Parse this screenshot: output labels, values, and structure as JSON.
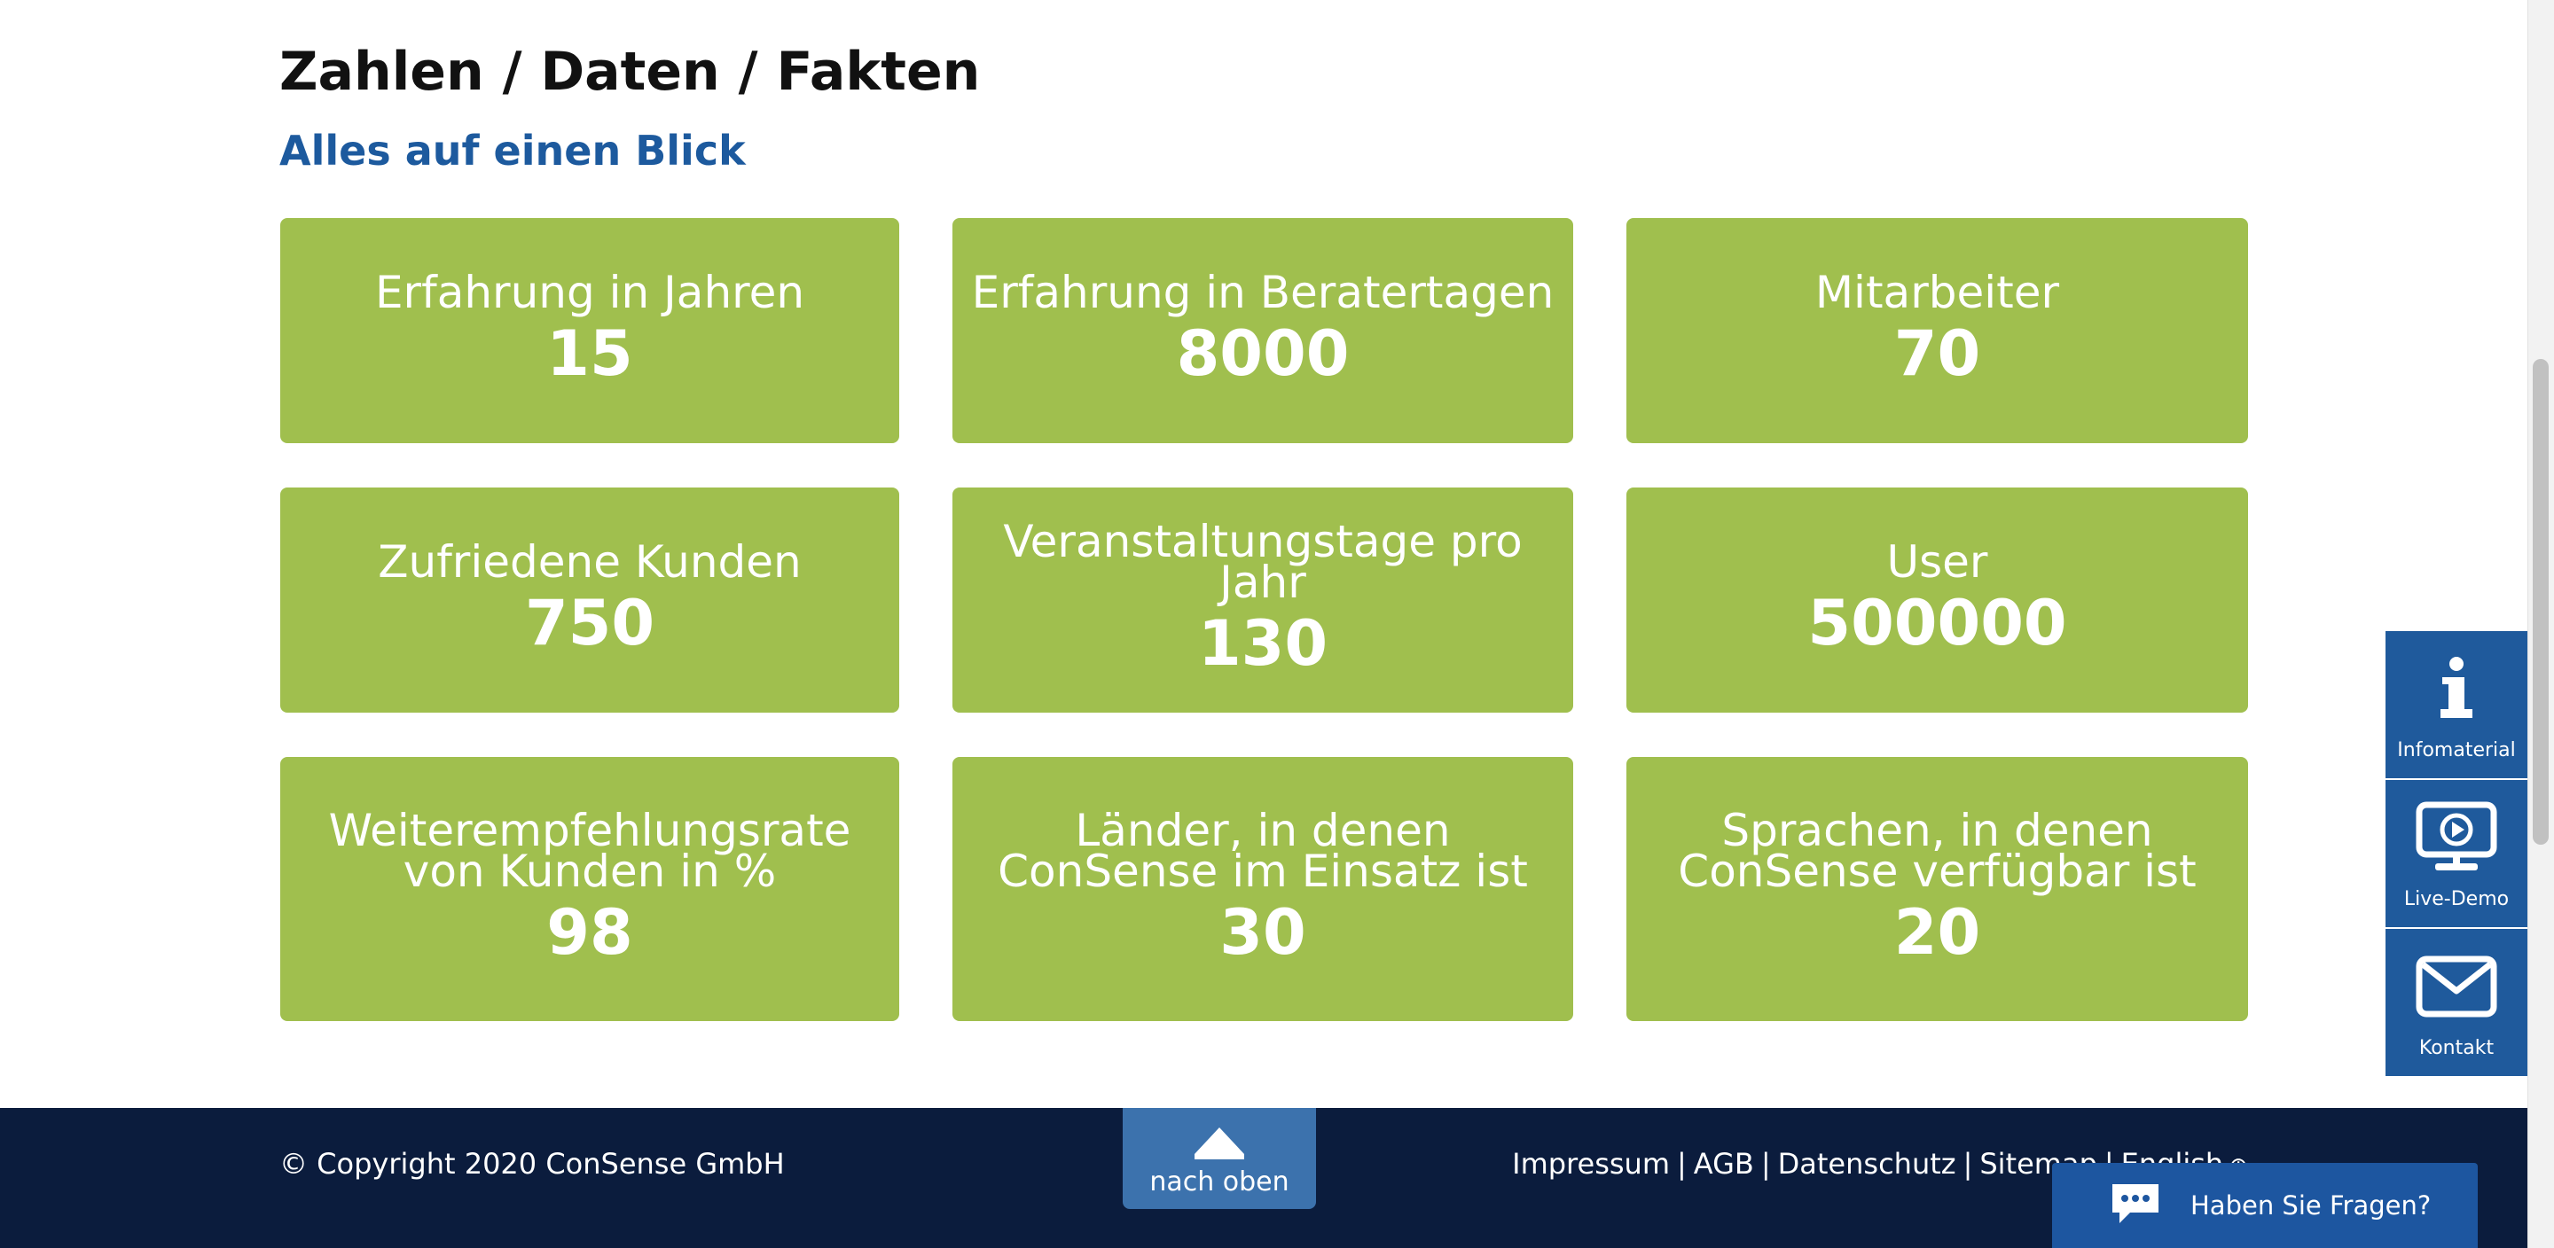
{
  "header": {
    "title": "Zahlen / Daten / Fakten",
    "subtitle": "Alles auf einen Blick"
  },
  "facts": [
    {
      "label": "Erfahrung in Jahren",
      "value": "15"
    },
    {
      "label": "Erfahrung in Beratertagen",
      "value": "8000"
    },
    {
      "label": "Mitarbeiter",
      "value": "70"
    },
    {
      "label": "Zufriedene Kunden",
      "value": "750"
    },
    {
      "label": "Veranstaltungstage pro Jahr",
      "value": "130"
    },
    {
      "label": "User",
      "value": "500000"
    },
    {
      "label": "Weiterempfehlungsrate von Kunden in %",
      "value": "98"
    },
    {
      "label": "Länder, in denen ConSense im Einsatz ist",
      "value": "30"
    },
    {
      "label": "Sprachen, in denen ConSense verfügbar ist",
      "value": "20"
    }
  ],
  "footer": {
    "copyright": "© Copyright 2020 ConSense GmbH",
    "links": [
      "Impressum",
      "AGB",
      "Datenschutz",
      "Sitemap",
      "English"
    ],
    "to_top_label": "nach oben"
  },
  "side_panel": [
    {
      "label": "Infomaterial",
      "icon": "info-icon"
    },
    {
      "label": "Live-Demo",
      "icon": "monitor-play-icon"
    },
    {
      "label": "Kontakt",
      "icon": "envelope-icon"
    }
  ],
  "chat": {
    "label": "Haben Sie Fragen?",
    "icon": "chat-bubble-icon"
  },
  "colors": {
    "tile_green": "#a0bf4e",
    "subtitle_blue": "#1d5a9e",
    "footer_navy": "#0b1c3d",
    "side_blue": "#1f5a9c",
    "to_top_blue": "#3c72ad"
  }
}
